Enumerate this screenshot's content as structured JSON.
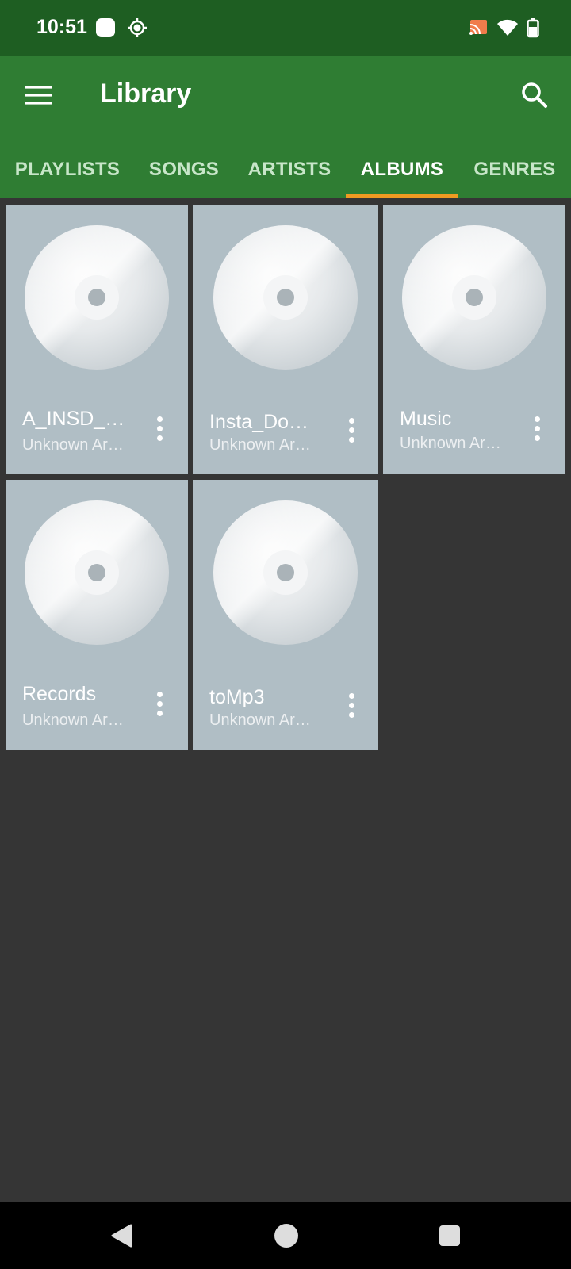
{
  "status": {
    "time": "10:51"
  },
  "header": {
    "title": "Library"
  },
  "tabs": [
    {
      "label": "PLAYLISTS"
    },
    {
      "label": "SONGS"
    },
    {
      "label": "ARTISTS"
    },
    {
      "label": "ALBUMS"
    },
    {
      "label": "GENRES"
    }
  ],
  "active_tab": "ALBUMS",
  "albums": [
    {
      "title": "A_INSD_…",
      "artist": "Unknown Ar…"
    },
    {
      "title": "Insta_Do…",
      "artist": "Unknown Ar…"
    },
    {
      "title": "Music",
      "artist": "Unknown Ar…"
    },
    {
      "title": "Records",
      "artist": "Unknown Ar…"
    },
    {
      "title": "toMp3",
      "artist": "Unknown Ar…"
    }
  ],
  "colors": {
    "status_bar": "#1e5e22",
    "app_bar": "#2f7d33",
    "accent": "#f09a22",
    "card": "#b0bec5",
    "background": "#353535"
  }
}
